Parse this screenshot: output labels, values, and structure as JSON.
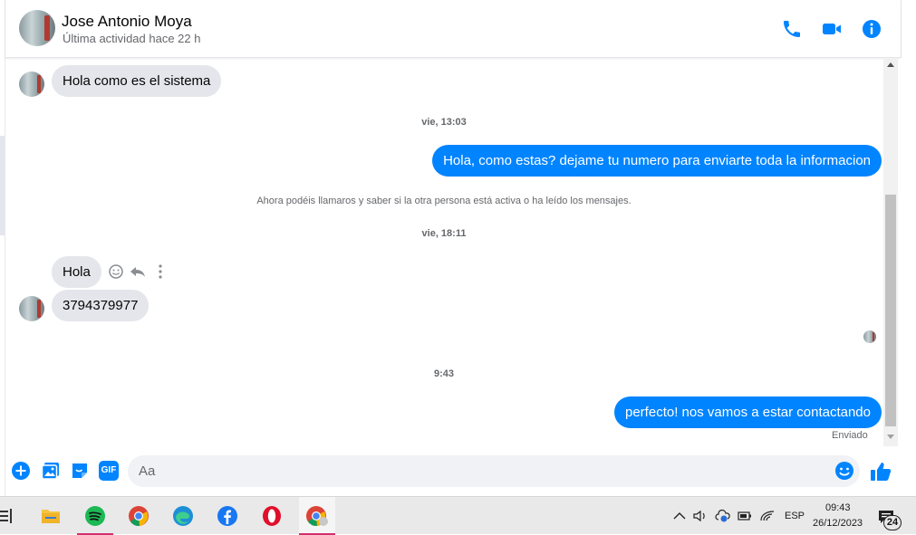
{
  "header": {
    "name": "Jose Antonio Moya",
    "status": "Última actividad hace 22 h"
  },
  "messages": [
    {
      "type": "in",
      "text": "Hola como es el sistema"
    },
    {
      "type": "timestamp",
      "text": "vie, 13:03"
    },
    {
      "type": "out",
      "text": "Hola, como estas? dejame tu numero para enviarte toda la informacion"
    },
    {
      "type": "notice",
      "text": "Ahora podéis llamaros y saber si la otra persona está activa o ha leído los mensajes."
    },
    {
      "type": "timestamp",
      "text": "vie, 18:11"
    },
    {
      "type": "in",
      "text": "Hola"
    },
    {
      "type": "in",
      "text": "3794379977"
    },
    {
      "type": "timestamp",
      "text": "9:43"
    },
    {
      "type": "out",
      "text": "perfecto! nos vamos a estar contactando"
    }
  ],
  "sent_status": "Enviado",
  "composer": {
    "placeholder": "Aa",
    "gif_label": "GIF"
  },
  "taskbar": {
    "language": "ESP",
    "time": "09:43",
    "date": "26/12/2023",
    "notification_count": "24"
  },
  "colors": {
    "accent": "#0084ff",
    "incoming_bubble": "#e4e6eb",
    "taskbar": "#e9e9ea"
  }
}
